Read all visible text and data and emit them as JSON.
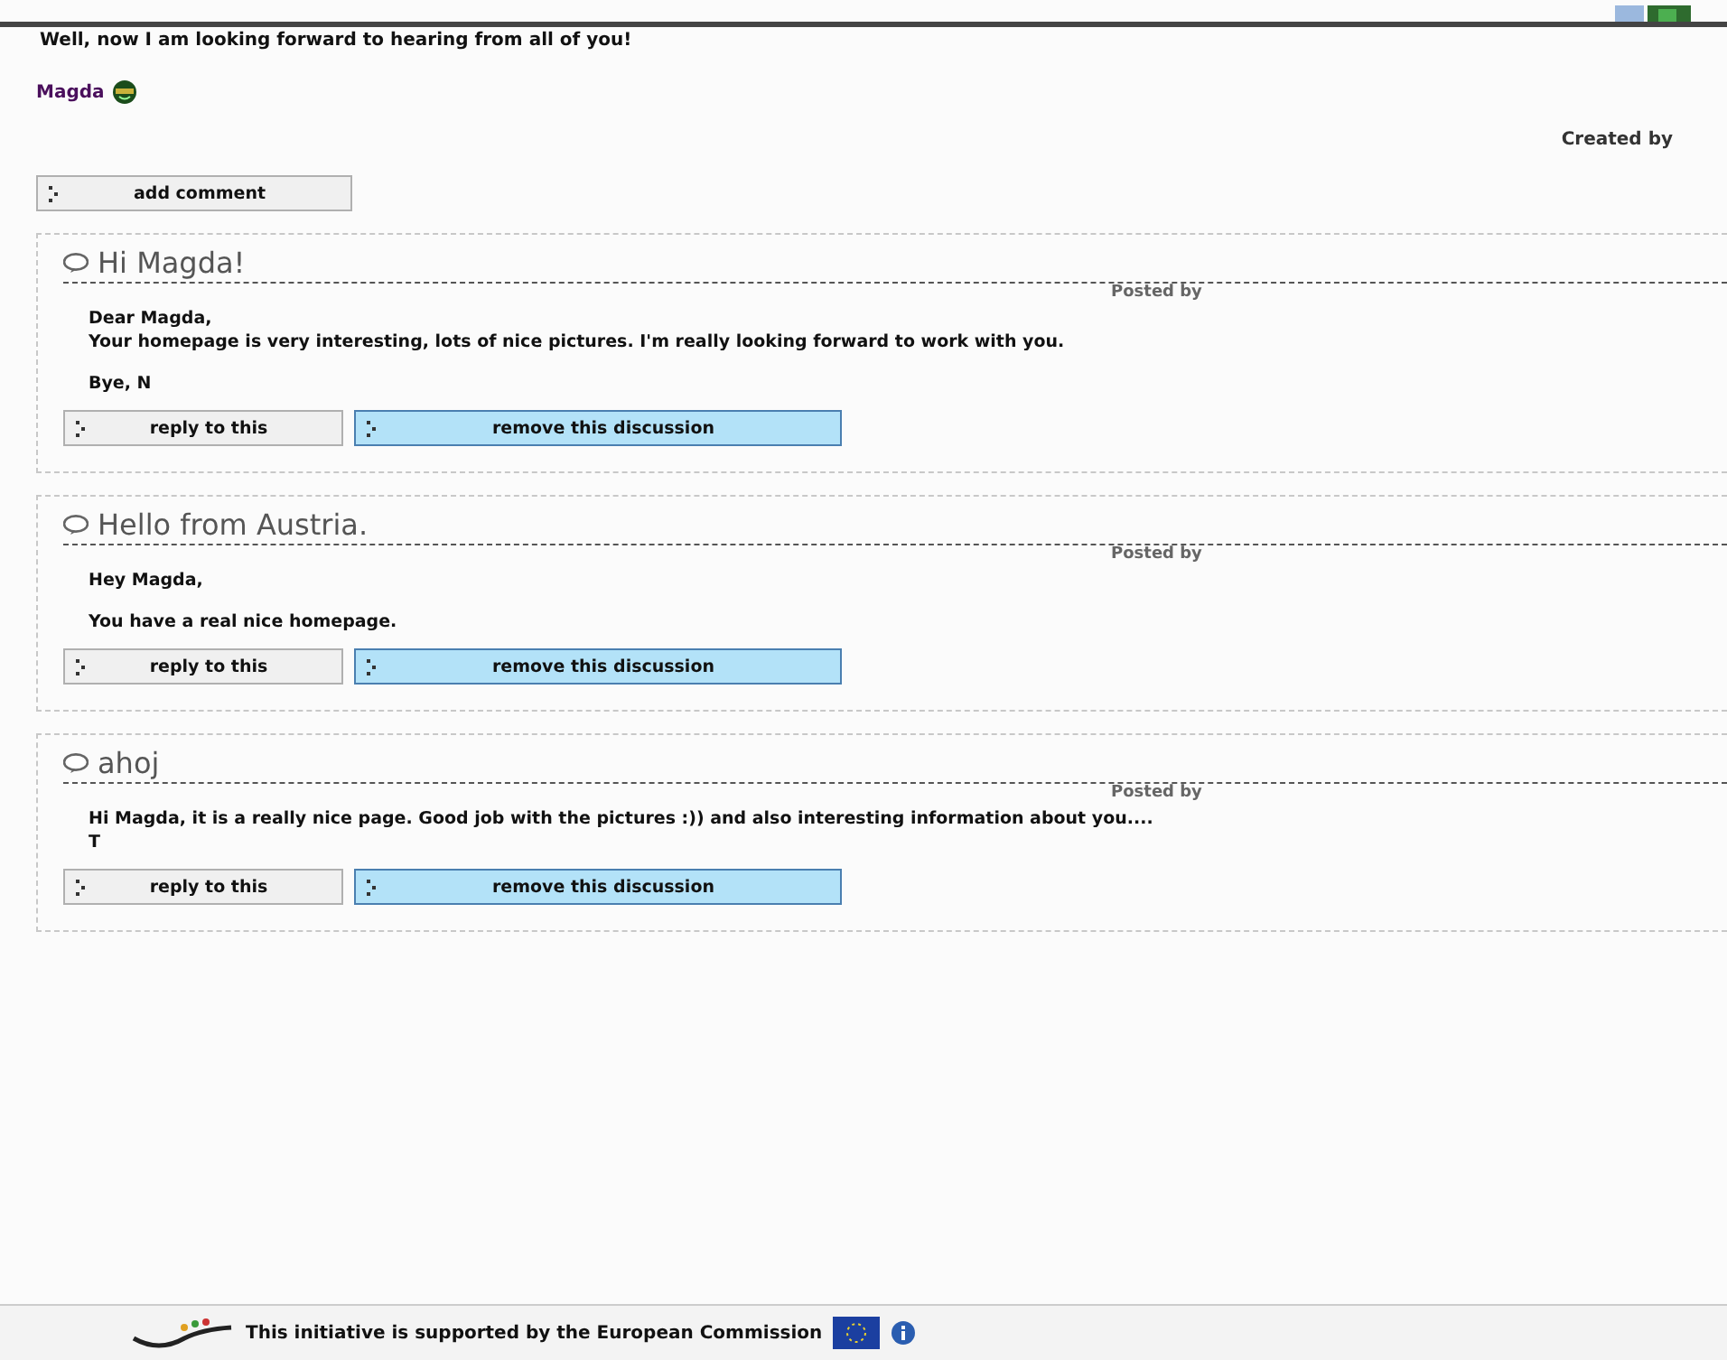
{
  "intro": "Well, now I am looking forward to hearing from all of you!",
  "author": "Magda",
  "created_label": "Created by",
  "add_button": "add comment",
  "discussions": [
    {
      "title": "Hi Magda!",
      "posted_label": "Posted by",
      "paragraphs": [
        [
          "Dear Magda,",
          "Your homepage is very interesting, lots of nice pictures. I'm really looking forward to work with you."
        ],
        [
          "Bye, N"
        ]
      ],
      "reply": "reply to this",
      "remove": "remove this discussion"
    },
    {
      "title": "Hello from Austria.",
      "posted_label": "Posted by",
      "paragraphs": [
        [
          "Hey Magda,"
        ],
        [
          "You have a real nice homepage."
        ]
      ],
      "reply": "reply to this",
      "remove": "remove this discussion"
    },
    {
      "title": "ahoj",
      "posted_label": "Posted by",
      "paragraphs": [
        [
          "Hi Magda, it is a really nice page. Good job with the pictures :)) and also interesting information about you....",
          "T"
        ]
      ],
      "reply": "reply to this",
      "remove": "remove this discussion"
    }
  ],
  "footer": "This initiative is supported by the European Commission"
}
